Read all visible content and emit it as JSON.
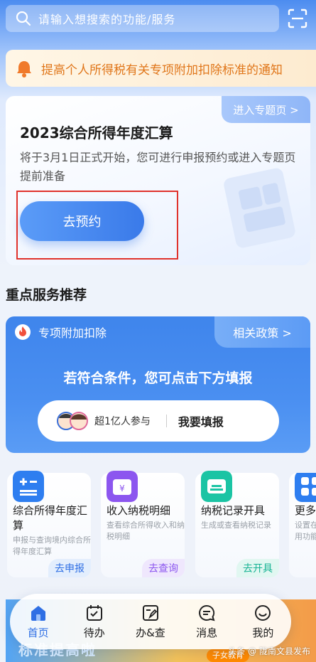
{
  "search": {
    "placeholder": "请输入想搜索的功能/服务"
  },
  "notice": {
    "text": "提高个人所得税有关专项附加扣除标准的通知"
  },
  "annual_card": {
    "tag": "进入专题页 >",
    "title": "2023综合所得年度汇算",
    "description": "将于3月1日正式开始，您可进行申报预约或进入专题页提前准备",
    "button": "去预约"
  },
  "section_title": "重点服务推荐",
  "special_card": {
    "label": "专项附加扣除",
    "policy": "相关政策 >",
    "condition": "若符合条件，您可点击下方填报",
    "participants": "超1亿人参与",
    "fill_button": "我要填报"
  },
  "tiles": [
    {
      "title": "综合所得年度汇算",
      "subtitle": "申报与查询境内综合所得年度汇算",
      "button": "去申报"
    },
    {
      "title": "收入纳税明细",
      "subtitle": "查看综合所得收入和纳税明细",
      "button": "去查询"
    },
    {
      "title": "纳税记录开具",
      "subtitle": "生成或查看纳税记录",
      "button": "去开具"
    },
    {
      "title": "更多",
      "subtitle": "设置在用功能"
    }
  ],
  "banner": {
    "text": "标准提高啦",
    "kids": "子女教育"
  },
  "tabbar": [
    {
      "label": "首页",
      "icon": "home-icon",
      "active": true
    },
    {
      "label": "待办",
      "icon": "calendar-check-icon"
    },
    {
      "label": "办&查",
      "icon": "document-edit-icon"
    },
    {
      "label": "消息",
      "icon": "message-icon"
    },
    {
      "label": "我的",
      "icon": "smile-icon"
    }
  ],
  "watermark": "头条 @ 陇南文县发布",
  "colors": {
    "primary": "#3a7ae9",
    "notice_text": "#e0761a",
    "highlight_box": "#e0322c"
  }
}
